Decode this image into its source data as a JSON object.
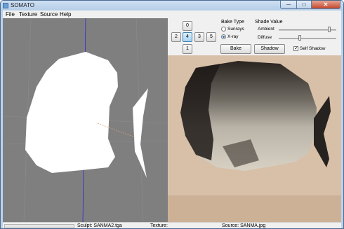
{
  "window": {
    "title": "SOMATO",
    "min_glyph": "─",
    "max_glyph": "□",
    "close_glyph": "✕"
  },
  "menu": {
    "items": [
      "File",
      "Texture",
      "Source",
      "Help"
    ]
  },
  "controls": {
    "view_buttons": [
      "0",
      "2",
      "4",
      "3",
      "5",
      "1"
    ],
    "active_view": "4",
    "bake_type": {
      "label": "Bake Type",
      "options": [
        "Sunrays",
        "X-ray"
      ],
      "selected": "X-ray"
    },
    "shade_value": {
      "label": "Shade Value",
      "ambient_label": "Ambient",
      "ambient_level": 0.88,
      "diffuse_label": "Diffuse",
      "diffuse_level": 0.35
    },
    "bake_button": "Bake",
    "shadow_button": "Shadow",
    "self_shadow": {
      "label": "Self Shadow",
      "checked": true
    }
  },
  "status": {
    "sculpt": "Sculpt: SANMA2.tga",
    "texture": "Texture:",
    "source": "Source: SANMA.jpg"
  },
  "icons": {
    "app": "app-icon",
    "check": "✓"
  },
  "colors": {
    "viewport_bg": "#7f7f7f",
    "silhouette": "#ffffff",
    "axis_blue": "#2b2bd6",
    "axis_orange": "#d9a07a"
  }
}
